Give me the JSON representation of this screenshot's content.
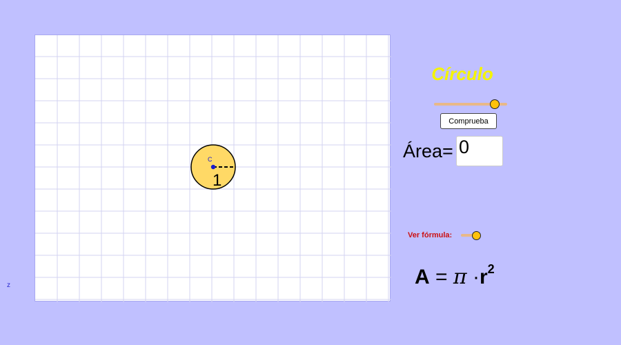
{
  "graphics": {
    "grid": true,
    "grid_color": "#d3d3f2",
    "circle": {
      "fill": "#ffd966",
      "stroke": "#000000",
      "radius_value": "1",
      "center_label": "C"
    },
    "axis_label": "z"
  },
  "panel": {
    "title": "Círculo",
    "title_color": "#f5f500",
    "radius_slider": {
      "level": 0.85
    },
    "check_button": "Comprueba",
    "area_label": "Área=",
    "area_value": "0",
    "formula_toggle_label": "Ver fórmula:",
    "formula_toggle": {
      "on": true
    },
    "formula": {
      "lhs": "A",
      "eq": "=",
      "pi": "π",
      "dot": "·",
      "var": "r",
      "exp": "2"
    }
  },
  "colors": {
    "background": "#c0c0ff",
    "knob": "#ffc20a",
    "track": "#e8b888",
    "label_red": "#cc1010"
  }
}
